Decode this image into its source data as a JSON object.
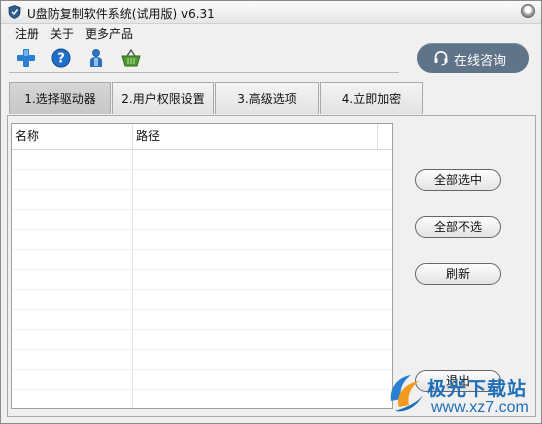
{
  "window": {
    "title": "U盘防复制软件系统(试用版) v6.31"
  },
  "menu": {
    "items": [
      "注册",
      "关于",
      "更多产品"
    ]
  },
  "toolbar": {
    "icons": [
      "add-icon",
      "help-icon",
      "user-icon",
      "basket-icon"
    ]
  },
  "online_consult": {
    "label": "在线咨询",
    "icon": "headset-icon"
  },
  "tabs": [
    {
      "label": "1.选择驱动器",
      "active": true
    },
    {
      "label": "2.用户权限设置",
      "active": false
    },
    {
      "label": "3.高级选项",
      "active": false
    },
    {
      "label": "4.立即加密",
      "active": false
    }
  ],
  "list": {
    "columns": [
      "名称",
      "路径"
    ]
  },
  "buttons": {
    "select_all": "全部选中",
    "select_none": "全部不选",
    "refresh": "刷新",
    "exit": "退出"
  },
  "watermark": {
    "line1": "极光下载站",
    "line2": "www.xz7.com"
  },
  "colors": {
    "accent": "#5f7488",
    "watermark": "#1f6fb8"
  }
}
